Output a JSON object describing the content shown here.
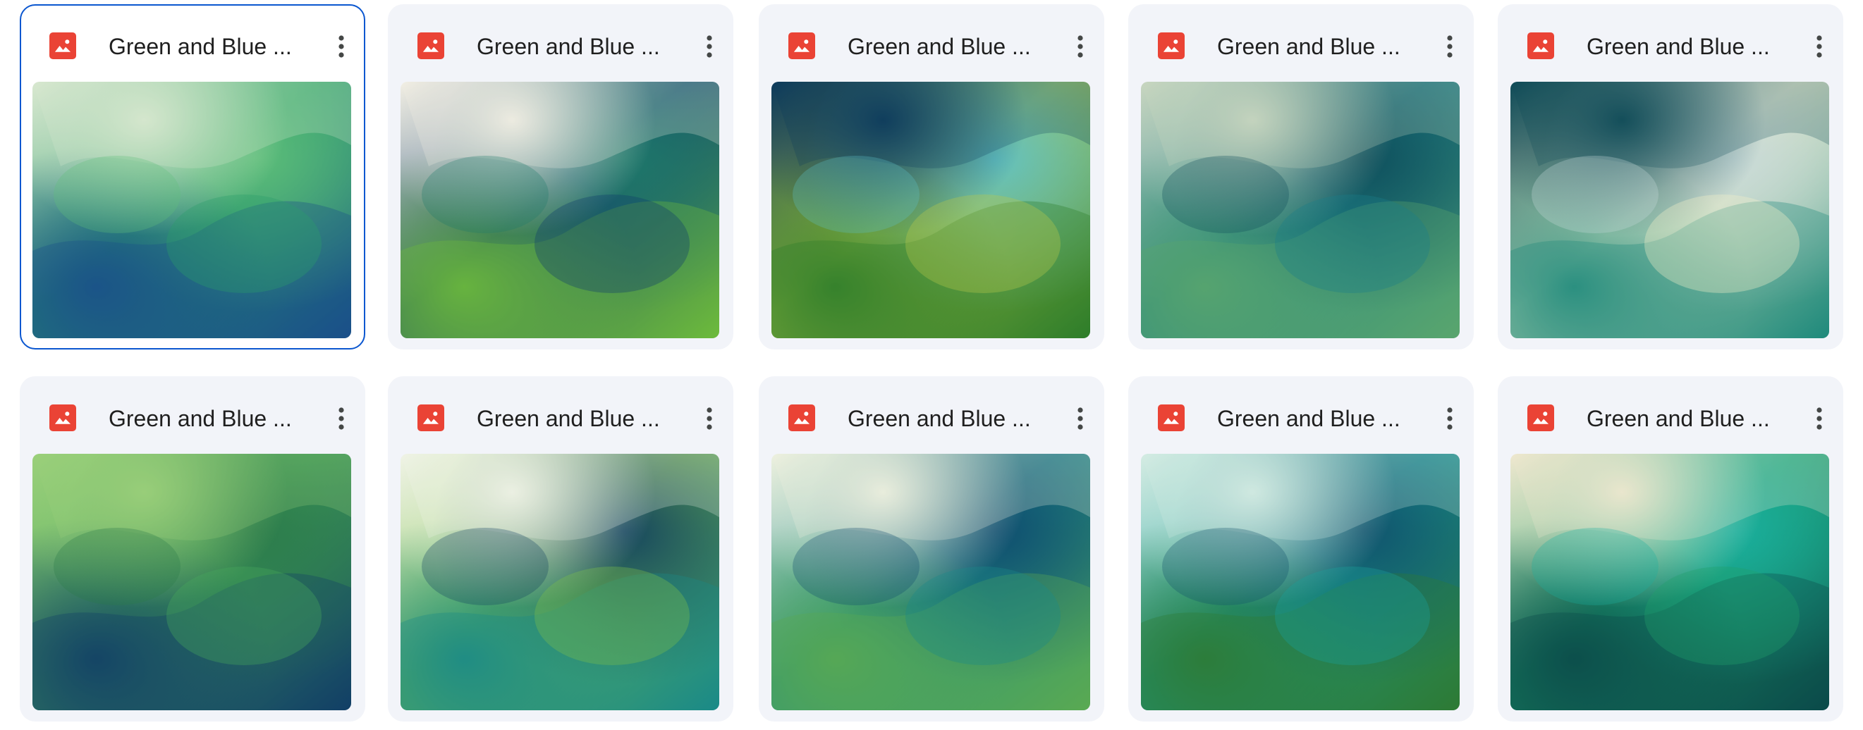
{
  "files": [
    {
      "title": "Green and Blue ...",
      "icon": "image-file-icon",
      "menu_icon": "more-vert-icon",
      "selected": true,
      "palette": {
        "c1": "#2a9d6b",
        "c2": "#1b4f8a",
        "c3": "#d9e8d0",
        "c4": "#5fbf7a"
      }
    },
    {
      "title": "Green and Blue ...",
      "icon": "image-file-icon",
      "menu_icon": "more-vert-icon",
      "selected": false,
      "palette": {
        "c1": "#0f3d6e",
        "c2": "#6dbb3c",
        "c3": "#f2efe4",
        "c4": "#1e7a6a"
      }
    },
    {
      "title": "Green and Blue ...",
      "icon": "image-file-icon",
      "menu_icon": "more-vert-icon",
      "selected": false,
      "palette": {
        "c1": "#b8c94a",
        "c2": "#2e7d2a",
        "c3": "#0d3a5c",
        "c4": "#5ec1c8"
      }
    },
    {
      "title": "Green and Blue ...",
      "icon": "image-file-icon",
      "menu_icon": "more-vert-icon",
      "selected": false,
      "palette": {
        "c1": "#1a7f8a",
        "c2": "#5aa56e",
        "c3": "#c9d6c0",
        "c4": "#0e4d5a"
      }
    },
    {
      "title": "Green and Blue ...",
      "icon": "image-file-icon",
      "menu_icon": "more-vert-icon",
      "selected": false,
      "palette": {
        "c1": "#f3f0c8",
        "c2": "#1f8a7c",
        "c3": "#0e4a57",
        "c4": "#c7d9d9"
      }
    },
    {
      "title": "Green and Blue ...",
      "icon": "image-file-icon",
      "menu_icon": "more-vert-icon",
      "selected": false,
      "palette": {
        "c1": "#49a85c",
        "c2": "#123f66",
        "c3": "#9bd07a",
        "c4": "#2a7a4a"
      }
    },
    {
      "title": "Green and Blue ...",
      "icon": "image-file-icon",
      "menu_icon": "more-vert-icon",
      "selected": false,
      "palette": {
        "c1": "#7cc14a",
        "c2": "#1b8a88",
        "c3": "#f0f3e6",
        "c4": "#0f3e5f"
      }
    },
    {
      "title": "Green and Blue ...",
      "icon": "image-file-icon",
      "menu_icon": "more-vert-icon",
      "selected": false,
      "palette": {
        "c1": "#1a8a8a",
        "c2": "#5aaa52",
        "c3": "#eef1df",
        "c4": "#0e4a6e"
      }
    },
    {
      "title": "Green and Blue ...",
      "icon": "image-file-icon",
      "menu_icon": "more-vert-icon",
      "selected": false,
      "palette": {
        "c1": "#1aa09a",
        "c2": "#2e7a35",
        "c3": "#d5ece3",
        "c4": "#0f4f6b"
      }
    },
    {
      "title": "Green and Blue ...",
      "icon": "image-file-icon",
      "menu_icon": "more-vert-icon",
      "selected": false,
      "palette": {
        "c1": "#1fa06a",
        "c2": "#0b4a4a",
        "c3": "#efe8cf",
        "c4": "#19b0a0"
      }
    }
  ],
  "colors": {
    "card_bg": "#f2f4f9",
    "selected_border": "#0b57d0",
    "file_icon": "#ea4335",
    "title_text": "#1f1f1f",
    "menu_dots": "#444746"
  }
}
